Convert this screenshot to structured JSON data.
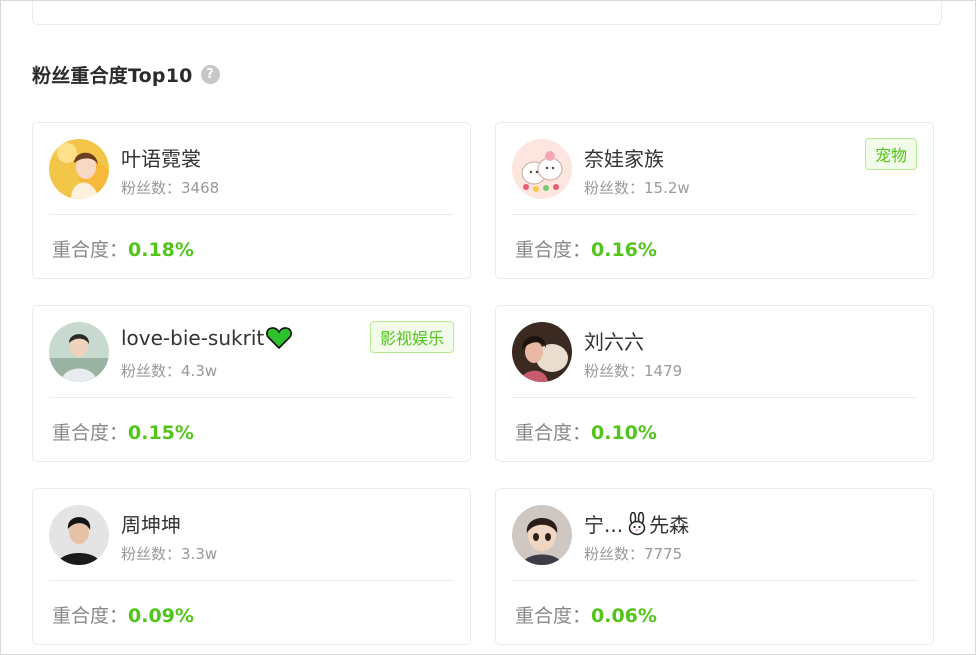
{
  "section": {
    "title": "粉丝重合度Top10",
    "help_icon": "question-circle-icon"
  },
  "labels": {
    "fans_prefix": "粉丝数：",
    "overlap_prefix": "重合度："
  },
  "colors": {
    "accent_green": "#52c41a",
    "tag_bg": "#f2fbea",
    "tag_border": "#b7eb8f"
  },
  "accounts": [
    {
      "name": "叶语霓裳",
      "fans": "3468",
      "overlap": "0.18%",
      "tag": ""
    },
    {
      "name": "奈娃家族",
      "fans": "15.2w",
      "overlap": "0.16%",
      "tag": "宠物"
    },
    {
      "name": "love-bie-sukrit",
      "name_icon": "green-heart-icon",
      "fans": "4.3w",
      "overlap": "0.15%",
      "tag": "影视娱乐"
    },
    {
      "name": "刘六六",
      "fans": "1479",
      "overlap": "0.10%",
      "tag": ""
    },
    {
      "name": "周坤坤",
      "fans": "3.3w",
      "overlap": "0.09%",
      "tag": ""
    },
    {
      "name_a": "宁...",
      "name_icon": "rabbit-icon",
      "name_b": "先森",
      "fans": "7775",
      "overlap": "0.06%",
      "tag": ""
    }
  ]
}
